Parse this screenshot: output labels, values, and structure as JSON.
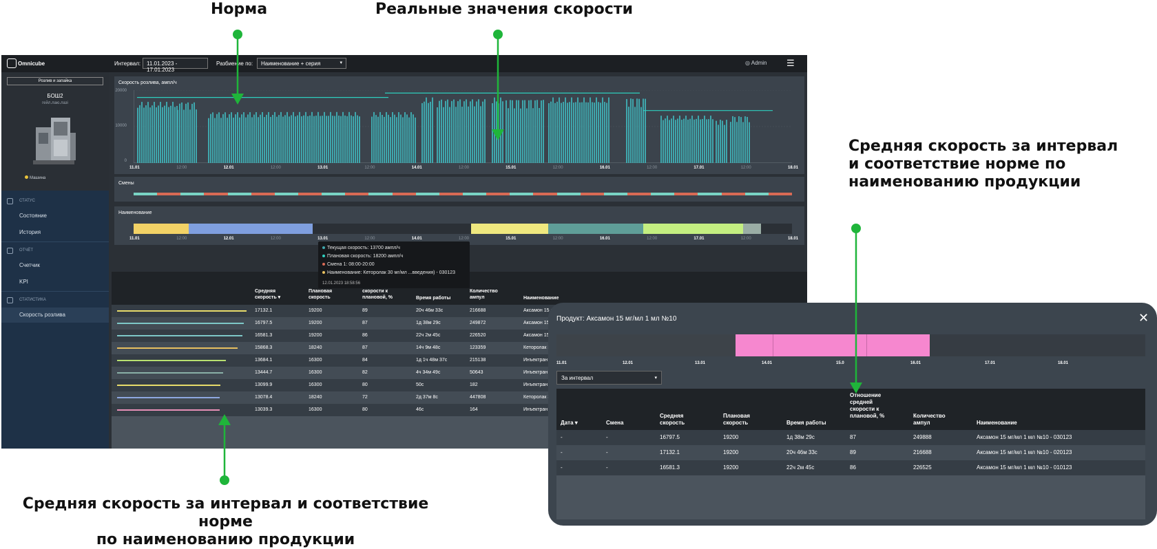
{
  "annotations": {
    "norm": "Норма",
    "real": "Реальные значения скорости",
    "right": [
      "Средняя скорость за интервал",
      "и соответствие норме по",
      "наименованию продукции"
    ],
    "bottom": [
      "Средняя скорость за интервал и соответствие норме",
      "по наименованию продукции"
    ]
  },
  "app": {
    "logo": "Omnicube",
    "interval_label": "Интервал:",
    "interval_value": "11.01.2023 - 17.01.2023",
    "split_label": "Разбиение по:",
    "split_value": "Наименование + серия",
    "user": "Admin"
  },
  "sidebar": {
    "button": "Розлив и запайка",
    "machine_name": "БОШ2",
    "machine_sub": "гейл.лаю.лазi",
    "status_text": "Машина",
    "sections": [
      {
        "label": "СТАТУС",
        "items": [
          "Состояние",
          "История"
        ]
      },
      {
        "label": "ОТЧЁТ",
        "items": [
          "Счетчик",
          "KPI"
        ]
      },
      {
        "label": "СТАТИСТИКА",
        "items": [
          "Скорость розлива"
        ]
      }
    ]
  },
  "speed_panel": {
    "title": "Скорость розлива, ампл/ч",
    "y_ticks": [
      "20000",
      "10000",
      "0"
    ]
  },
  "x_ticks": [
    "11.01",
    "12:00",
    "12.01",
    "12:00",
    "13.01",
    "12:00",
    "14.01",
    "12:00",
    "15.01",
    "12:00",
    "16.01",
    "12:00",
    "17.01",
    "12:00",
    "18.01"
  ],
  "shifts_panel": {
    "title": "Смены"
  },
  "names_panel": {
    "title": "Наименование"
  },
  "tooltip": {
    "current": "Текущая скорость: 13700 ампл/ч",
    "plan": "Плановая скорость: 18200 ампл/ч",
    "shift": "Смена 1: 08:00-20:00",
    "name": "Наименование: Кеторолак 30 мг/мл ...введения) - 030123",
    "stamp": "12.01.2023 18:58:56"
  },
  "table": {
    "headers": [
      "Средняя скорость ▾",
      "Плановая скорость",
      "скорости к плановой, %",
      "Время работы",
      "Количество ампул",
      "Наименование"
    ],
    "rows": [
      {
        "color": "#e8dc6a",
        "bar": 1.0,
        "avg": "17132.1",
        "plan": "19200",
        "pct": "89",
        "time": "20ч 46м 33с",
        "qty": "216688",
        "name": "Аксамон 15 мг"
      },
      {
        "color": "#7ec8c8",
        "bar": 0.98,
        "avg": "16797.5",
        "plan": "19200",
        "pct": "87",
        "time": "1д 38м 29с",
        "qty": "249872",
        "name": "Аксамон 15"
      },
      {
        "color": "#7ec8c8",
        "bar": 0.97,
        "avg": "16581.3",
        "plan": "19200",
        "pct": "86",
        "time": "22ч 2м 45с",
        "qty": "226520",
        "name": "Аксамон 15"
      },
      {
        "color": "#e8c060",
        "bar": 0.93,
        "avg": "15868.3",
        "plan": "18240",
        "pct": "87",
        "time": "14ч 9м 48с",
        "qty": "123359",
        "name": "Кеторолак 3"
      },
      {
        "color": "#b8e070",
        "bar": 0.84,
        "avg": "13684.1",
        "plan": "16300",
        "pct": "84",
        "time": "1д 1ч 48м 37с",
        "qty": "215138",
        "name": "Инъектран"
      },
      {
        "color": "#8ab0a8",
        "bar": 0.82,
        "avg": "13444.7",
        "plan": "16300",
        "pct": "82",
        "time": "4ч 34м 49с",
        "qty": "50643",
        "name": "Инъектран"
      },
      {
        "color": "#e8dc6a",
        "bar": 0.8,
        "avg": "13099.9",
        "plan": "16300",
        "pct": "80",
        "time": "50с",
        "qty": "182",
        "name": "Инъектран"
      },
      {
        "color": "#8ea8e0",
        "bar": 0.79,
        "avg": "13078.4",
        "plan": "18240",
        "pct": "72",
        "time": "2д 37м 8с",
        "qty": "447808",
        "name": "Кеторолак 3"
      },
      {
        "color": "#e890b8",
        "bar": 0.79,
        "avg": "13039.3",
        "plan": "16300",
        "pct": "80",
        "time": "46с",
        "qty": "164",
        "name": "Инъектран"
      }
    ]
  },
  "popup": {
    "title": "Продукт: Аксамон 15 мг/мл 1 мл №10",
    "ticks": [
      "11.01",
      "12.01",
      "13.01",
      "14.01",
      "15.0",
      "16.01",
      "17.01",
      "18.01"
    ],
    "select": "За интервал",
    "headers": [
      "Дата ▾",
      "Смена",
      "Средняя скорость",
      "Плановая скорость",
      "Время работы",
      "Отношение средней скорости к плановой, %",
      "Количество ампул",
      "Наименование"
    ],
    "rows": [
      {
        "date": "-",
        "shift": "-",
        "avg": "16797.5",
        "plan": "19200",
        "time": "1д 38м 29с",
        "pct": "87",
        "qty": "249888",
        "name": "Аксамон 15 мг/мл 1 мл №10 - 030123"
      },
      {
        "date": "-",
        "shift": "-",
        "avg": "17132.1",
        "plan": "19200",
        "time": "20ч 46м 33с",
        "pct": "89",
        "qty": "216688",
        "name": "Аксамон 15 мг/мл 1 мл №10 - 020123"
      },
      {
        "date": "-",
        "shift": "-",
        "avg": "16581.3",
        "plan": "19200",
        "time": "22ч 2м 45с",
        "pct": "86",
        "qty": "226525",
        "name": "Аксамон 15 мг/мл 1 мл №10 - 010123"
      }
    ]
  },
  "colors": {
    "accent_green": "#1fb53a",
    "bar_teal": "#3fa7ad",
    "norm_line": "#2ecfbf",
    "shift_teal": "#79d4c4",
    "shift_red": "#d86a55",
    "highlight_pink": "#f687cf"
  }
}
